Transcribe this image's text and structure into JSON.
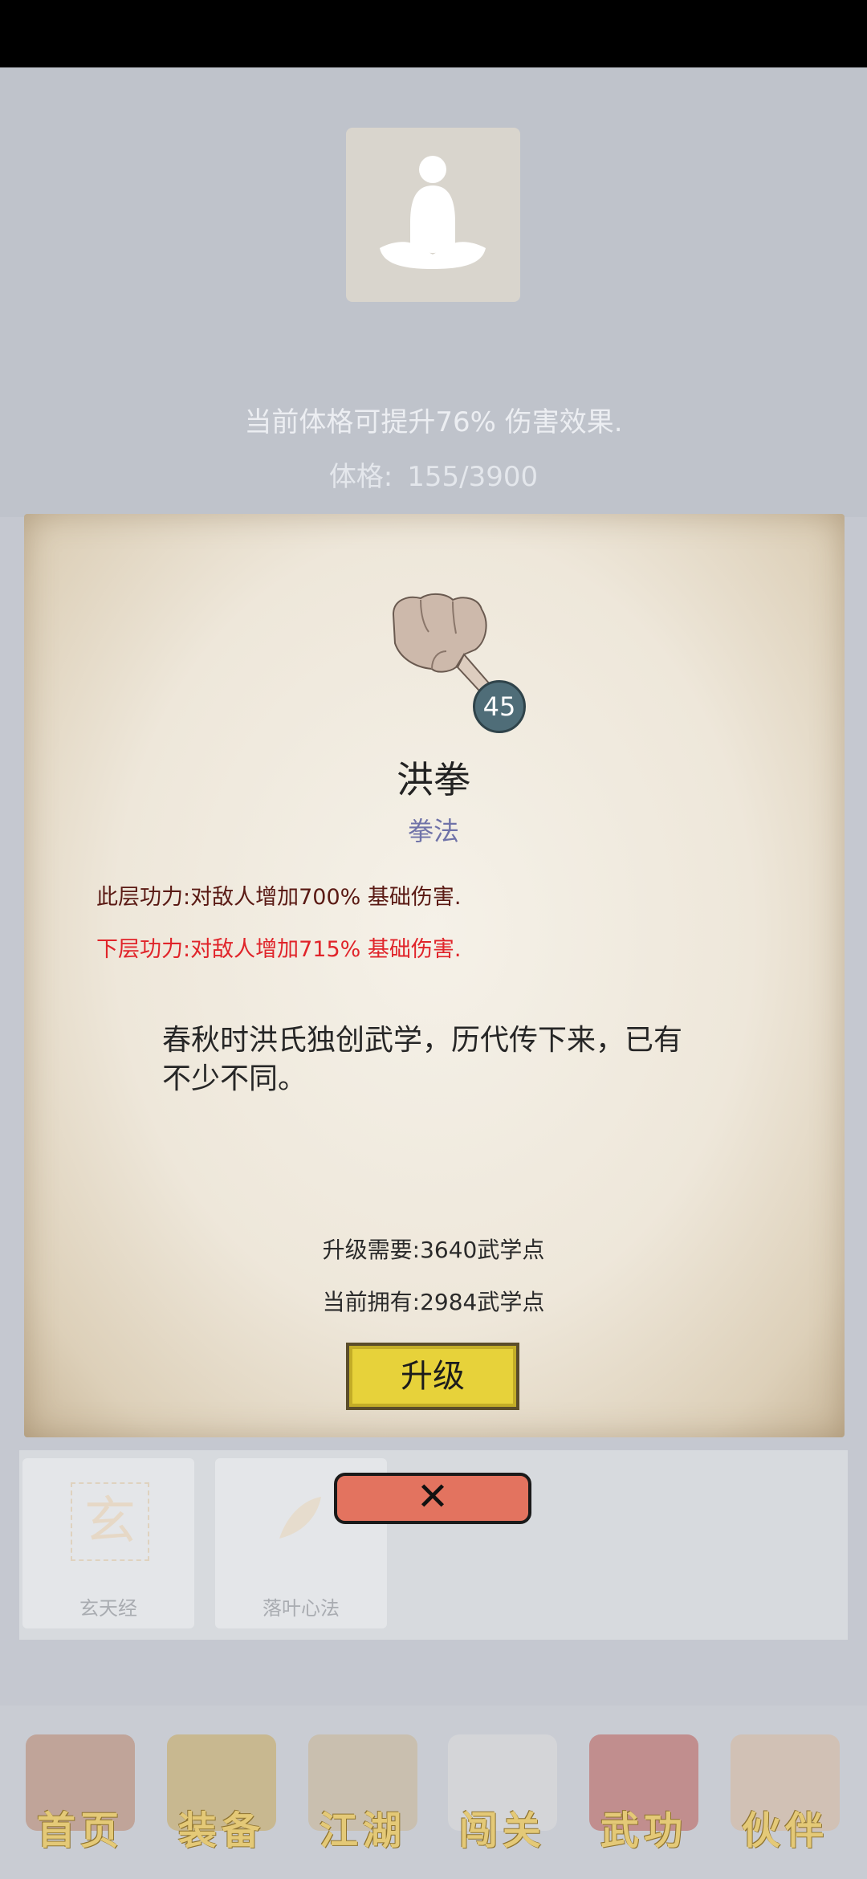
{
  "header": {
    "tip": "当前体格可提升76% 伤害效果.",
    "physique_label": "体格:",
    "physique_value": "155/3900"
  },
  "skill": {
    "level": "45",
    "name": "洪拳",
    "type": "拳法",
    "current_level_text": "此层功力:对敌人增加700% 基础伤害.",
    "next_level_text": "下层功力:对敌人增加715% 基础伤害.",
    "description": "春秋时洪氏独创武学，历代传下来，已有不少不同。",
    "upgrade_need": "升级需要:3640武学点",
    "current_have": "当前拥有:2984武学点",
    "upgrade_label": "升级",
    "close_label": "✕"
  },
  "list": {
    "items": [
      {
        "label": "玄天经",
        "icon": "玄"
      },
      {
        "label": "落叶心法"
      }
    ]
  },
  "nav": {
    "items": [
      {
        "label": "首页"
      },
      {
        "label": "装备"
      },
      {
        "label": "江湖"
      },
      {
        "label": "闯关"
      },
      {
        "label": "武功"
      },
      {
        "label": "伙伴"
      }
    ]
  },
  "colors": {
    "upgrade_button": "#e7d23a",
    "close_button": "#e3735f",
    "next_level_text": "#e0242a",
    "nav_text": "#e4c977"
  }
}
